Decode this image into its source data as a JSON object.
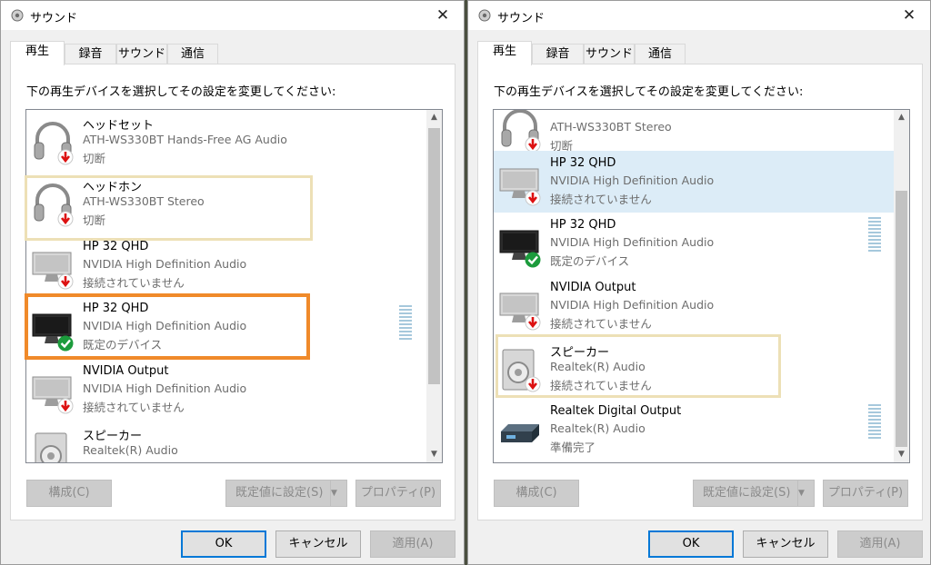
{
  "window": {
    "title": "サウンド",
    "close_glyph": "✕"
  },
  "tabs": [
    "再生",
    "録音",
    "サウンド",
    "通信"
  ],
  "instruction": "下の再生デバイスを選択してその設定を変更してください:",
  "colors": {
    "highlight": "#dcecf7",
    "orange_frame": "#f08a2a",
    "beige_frame": "#ede0b6",
    "vu_meter": "#a6c8dc",
    "primary_border": "#0078d7"
  },
  "left_list": [
    {
      "name": "ヘッドセット",
      "driver": "ATH-WS330BT Hands-Free AG Audio",
      "status": "切断",
      "icon": "headphones-icon",
      "badge": "red-down-arrow-icon"
    },
    {
      "name": "ヘッドホン",
      "driver": "ATH-WS330BT Stereo",
      "status": "切断",
      "icon": "headphones-icon",
      "badge": "red-down-arrow-icon"
    },
    {
      "name": "HP 32 QHD",
      "driver": "NVIDIA High Definition Audio",
      "status": "接続されていません",
      "icon": "monitor-icon",
      "badge": "red-down-arrow-icon"
    },
    {
      "name": "HP 32 QHD",
      "driver": "NVIDIA High Definition Audio",
      "status": "既定のデバイス",
      "icon": "monitor-dark-icon",
      "badge": "green-check-icon"
    },
    {
      "name": "NVIDIA Output",
      "driver": "NVIDIA High Definition Audio",
      "status": "接続されていません",
      "icon": "monitor-icon",
      "badge": "red-down-arrow-icon"
    },
    {
      "name": "スピーカー",
      "driver": "Realtek(R) Audio",
      "status": "",
      "icon": "speaker-icon",
      "badge": ""
    }
  ],
  "right_list": [
    {
      "name": "",
      "driver": "ATH-WS330BT Stereo",
      "status": "切断",
      "icon": "headphones-icon",
      "badge": "red-down-arrow-icon"
    },
    {
      "name": "HP 32 QHD",
      "driver": "NVIDIA High Definition Audio",
      "status": "接続されていません",
      "icon": "monitor-icon",
      "badge": "red-down-arrow-icon"
    },
    {
      "name": "HP 32 QHD",
      "driver": "NVIDIA High Definition Audio",
      "status": "既定のデバイス",
      "icon": "monitor-dark-icon",
      "badge": "green-check-icon"
    },
    {
      "name": "NVIDIA Output",
      "driver": "NVIDIA High Definition Audio",
      "status": "接続されていません",
      "icon": "monitor-icon",
      "badge": "red-down-arrow-icon"
    },
    {
      "name": "スピーカー",
      "driver": "Realtek(R) Audio",
      "status": "接続されていません",
      "icon": "speaker-icon",
      "badge": "red-down-arrow-icon"
    },
    {
      "name": "Realtek Digital Output",
      "driver": "Realtek(R) Audio",
      "status": "準備完了",
      "icon": "digital-output-icon",
      "badge": ""
    }
  ],
  "buttons": {
    "configure": "構成(C)",
    "set_default": "既定値に設定(S)",
    "properties": "プロパティ(P)",
    "ok": "OK",
    "cancel": "キャンセル",
    "apply": "適用(A)"
  }
}
